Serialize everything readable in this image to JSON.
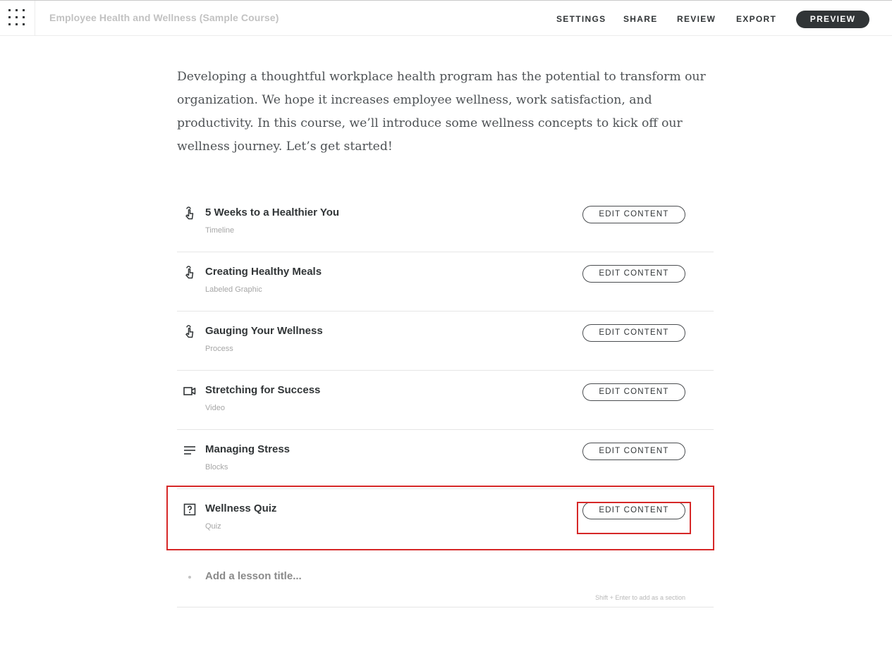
{
  "app": {
    "course_title": "Employee Health and Wellness (Sample Course)",
    "menu_icon": "grid-icon"
  },
  "nav": {
    "settings": "SETTINGS",
    "share": "SHARE",
    "review": "REVIEW",
    "export": "EXPORT",
    "preview": "PREVIEW"
  },
  "intro": {
    "text": "Developing a thoughtful workplace health program has the potential to transform our organization. We hope it increases employee wellness, work satisfaction, and productivity. In this course, we’ll introduce some wellness concepts to kick off our wellness journey. Let’s get started!"
  },
  "lessons": [
    {
      "title": "5 Weeks to a Healthier You",
      "type": "Timeline",
      "icon": "interactive-hand-icon",
      "button": "EDIT CONTENT"
    },
    {
      "title": "Creating Healthy Meals",
      "type": "Labeled Graphic",
      "icon": "interactive-hand-icon",
      "button": "EDIT CONTENT"
    },
    {
      "title": "Gauging Your Wellness",
      "type": "Process",
      "icon": "interactive-hand-icon",
      "button": "EDIT CONTENT"
    },
    {
      "title": "Stretching for Success",
      "type": "Video",
      "icon": "video-camera-icon",
      "button": "EDIT CONTENT"
    },
    {
      "title": "Managing Stress",
      "type": "Blocks",
      "icon": "text-lines-icon",
      "button": "EDIT CONTENT"
    },
    {
      "title": "Wellness Quiz",
      "type": "Quiz",
      "icon": "question-box-icon",
      "button": "EDIT CONTENT"
    }
  ],
  "add_lesson": {
    "placeholder": "Add a lesson title...",
    "hint": "Shift + Enter to add as a section"
  },
  "colors": {
    "text": "#313537",
    "muted": "#a6a6a6",
    "highlight": "#d62828"
  }
}
